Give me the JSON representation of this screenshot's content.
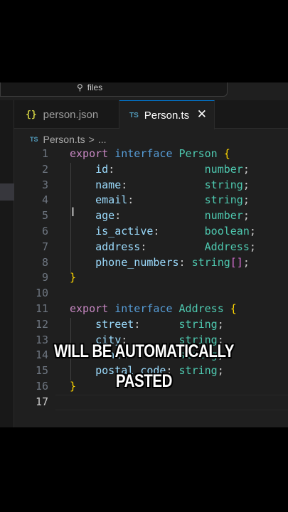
{
  "search": {
    "text": "files"
  },
  "tabs": [
    {
      "label": "person.json",
      "icon": "{}"
    },
    {
      "label": "Person.ts",
      "icon": "TS",
      "close": "✕"
    }
  ],
  "breadcrumb": {
    "icon": "TS",
    "file": "Person.ts",
    "separator": ">",
    "more": "..."
  },
  "caption": {
    "line1": "WILL BE AUTOMATICALLY",
    "line2": "PASTED"
  },
  "editor": {
    "lines": [
      {
        "n": "1",
        "tokens": [
          [
            "kw2",
            "export"
          ],
          [
            "punc",
            " "
          ],
          [
            "kw",
            "interface"
          ],
          [
            "punc",
            " "
          ],
          [
            "type",
            "Person"
          ],
          [
            "punc",
            " "
          ],
          [
            "brace",
            "{"
          ]
        ]
      },
      {
        "n": "2",
        "tokens": [
          [
            "punc",
            "    "
          ],
          [
            "prop",
            "id"
          ],
          [
            "punc",
            ":              "
          ],
          [
            "type",
            "number"
          ],
          [
            "punc",
            ";"
          ]
        ]
      },
      {
        "n": "3",
        "tokens": [
          [
            "punc",
            "    "
          ],
          [
            "prop",
            "name"
          ],
          [
            "punc",
            ":            "
          ],
          [
            "type",
            "string"
          ],
          [
            "punc",
            ";"
          ]
        ]
      },
      {
        "n": "4",
        "tokens": [
          [
            "punc",
            "    "
          ],
          [
            "prop",
            "email"
          ],
          [
            "punc",
            ":           "
          ],
          [
            "type",
            "string"
          ],
          [
            "punc",
            ";"
          ]
        ]
      },
      {
        "n": "5",
        "tokens": [
          [
            "punc",
            "    "
          ],
          [
            "prop",
            "age"
          ],
          [
            "punc",
            ":             "
          ],
          [
            "type",
            "number"
          ],
          [
            "punc",
            ";"
          ]
        ]
      },
      {
        "n": "6",
        "tokens": [
          [
            "punc",
            "    "
          ],
          [
            "prop",
            "is_active"
          ],
          [
            "punc",
            ":       "
          ],
          [
            "type",
            "boolean"
          ],
          [
            "punc",
            ";"
          ]
        ]
      },
      {
        "n": "7",
        "tokens": [
          [
            "punc",
            "    "
          ],
          [
            "prop",
            "address"
          ],
          [
            "punc",
            ":         "
          ],
          [
            "type",
            "Address"
          ],
          [
            "punc",
            ";"
          ]
        ]
      },
      {
        "n": "8",
        "tokens": [
          [
            "punc",
            "    "
          ],
          [
            "prop",
            "phone_numbers"
          ],
          [
            "punc",
            ": "
          ],
          [
            "type",
            "string"
          ],
          [
            "bracket",
            "[]"
          ],
          [
            "punc",
            ";"
          ]
        ]
      },
      {
        "n": "9",
        "tokens": [
          [
            "brace",
            "}"
          ]
        ]
      },
      {
        "n": "10",
        "tokens": []
      },
      {
        "n": "11",
        "tokens": [
          [
            "kw2",
            "export"
          ],
          [
            "punc",
            " "
          ],
          [
            "kw",
            "interface"
          ],
          [
            "punc",
            " "
          ],
          [
            "type",
            "Address"
          ],
          [
            "punc",
            " "
          ],
          [
            "brace",
            "{"
          ]
        ]
      },
      {
        "n": "12",
        "tokens": [
          [
            "punc",
            "    "
          ],
          [
            "prop",
            "street"
          ],
          [
            "punc",
            ":      "
          ],
          [
            "type",
            "string"
          ],
          [
            "punc",
            ";"
          ]
        ]
      },
      {
        "n": "13",
        "tokens": [
          [
            "punc",
            "    "
          ],
          [
            "prop",
            "city"
          ],
          [
            "punc",
            ":        "
          ],
          [
            "type",
            "string"
          ],
          [
            "punc",
            ";"
          ]
        ]
      },
      {
        "n": "14",
        "tokens": [
          [
            "punc",
            "    "
          ],
          [
            "prop",
            "state"
          ],
          [
            "punc",
            ":       "
          ],
          [
            "type",
            "string"
          ],
          [
            "punc",
            ";"
          ]
        ]
      },
      {
        "n": "15",
        "tokens": [
          [
            "punc",
            "    "
          ],
          [
            "prop",
            "postal_code"
          ],
          [
            "punc",
            ": "
          ],
          [
            "type",
            "string"
          ],
          [
            "punc",
            ";"
          ]
        ]
      },
      {
        "n": "16",
        "tokens": [
          [
            "brace",
            "}"
          ]
        ]
      },
      {
        "n": "17",
        "tokens": []
      }
    ]
  }
}
